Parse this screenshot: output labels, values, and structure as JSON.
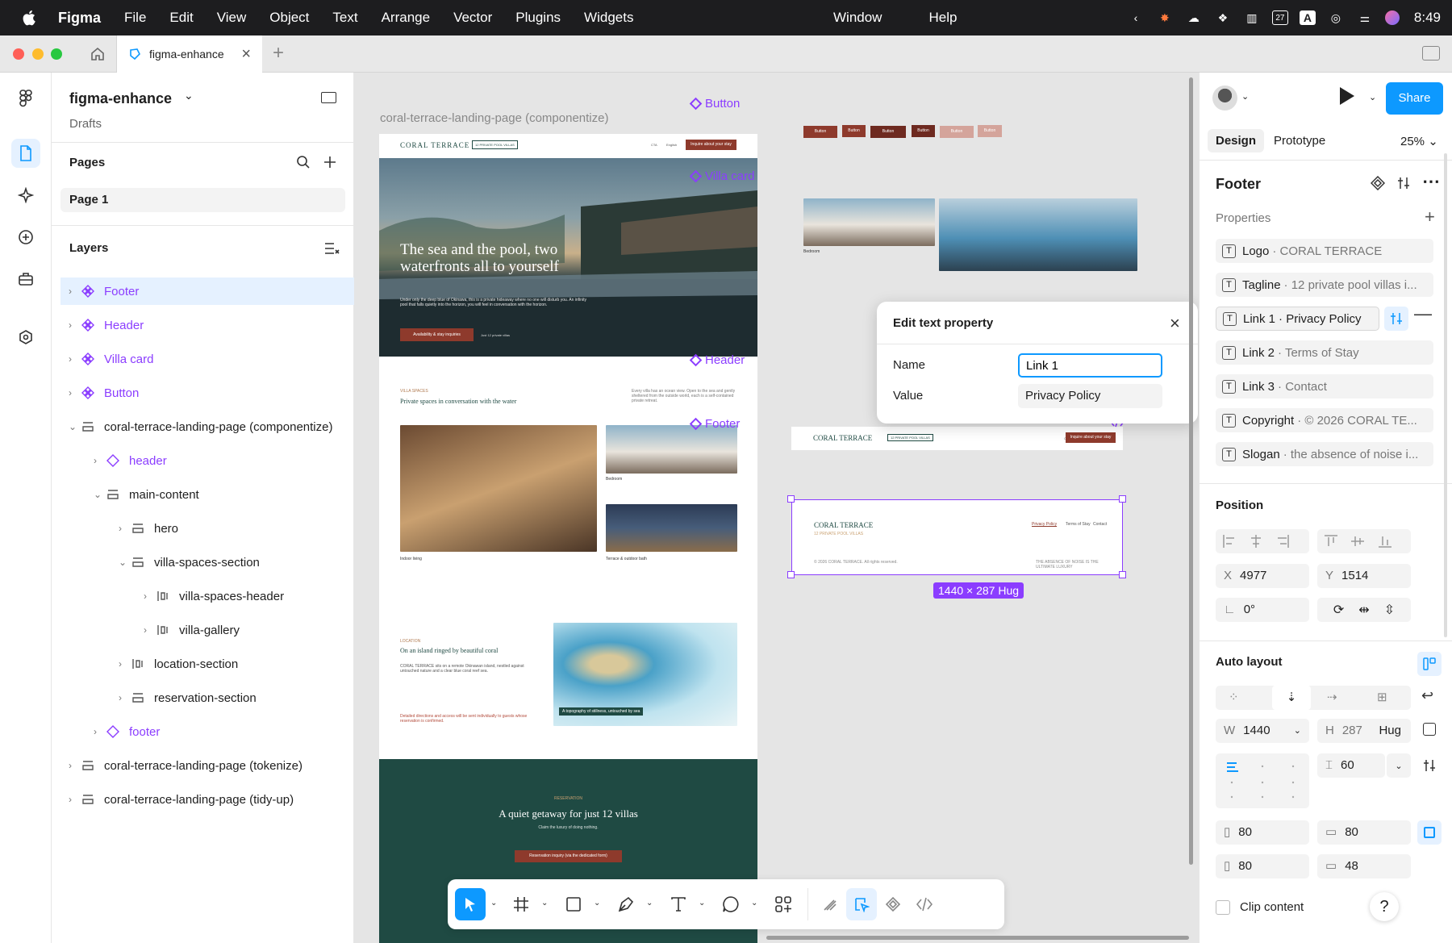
{
  "menubar": {
    "app": "Figma",
    "items": [
      "File",
      "Edit",
      "View",
      "Object",
      "Text",
      "Arrange",
      "Vector",
      "Plugins",
      "Widgets"
    ],
    "right_items": [
      "Window",
      "Help"
    ],
    "clock": "8:49",
    "calendar_day": "27"
  },
  "tabs": {
    "active": "figma-enhance"
  },
  "file": {
    "name": "figma-enhance",
    "location": "Drafts"
  },
  "pages": {
    "title": "Pages",
    "items": [
      "Page 1"
    ]
  },
  "layers": {
    "title": "Layers",
    "items": [
      "Footer",
      "Header",
      "Villa card",
      "Button",
      "coral-terrace-landing-page (componentize)",
      "header",
      "main-content",
      "hero",
      "villa-spaces-section",
      "villa-spaces-header",
      "villa-gallery",
      "location-section",
      "reservation-section",
      "footer",
      "coral-terrace-landing-page (tokenize)",
      "coral-terrace-landing-page (tidy-up)"
    ]
  },
  "canvas": {
    "frame_title": "coral-terrace-landing-page (componentize)",
    "components": {
      "button": "Button",
      "villa_card": "Villa card",
      "header": "Header",
      "footer": "Footer"
    },
    "size_badge": "1440 × 287 Hug",
    "button_variants": [
      "Button",
      "Button",
      "Button",
      "Button",
      "Button",
      "Button"
    ],
    "landing": {
      "brand": "CORAL TERRACE",
      "tag": "12 PRIVATE POOL VILLAS",
      "nav": [
        "CTA",
        "English"
      ],
      "cta": "Inquire about your stay",
      "hero_title": "The sea and the pool, two waterfronts all to yourself",
      "hero_body": "Under only the deep blue of Okinawa, this is a private hideaway where no one will disturb you. An infinity pool that falls quietly into the horizon, you will feel in conversation with the horizon.",
      "hero_btn": "Availability & stay inquiries",
      "hero_note": "Just 12 private villas",
      "spaces_kicker": "VILLA SPACES",
      "spaces_title": "Private spaces in conversation with the water",
      "spaces_body": "Every villa has an ocean view. Open to the sea and gently sheltered from the outside world, each is a self-contained private retreat.",
      "captions": [
        "Indoor living",
        "Bedroom",
        "Terrace & outdoor bath"
      ],
      "location_kicker": "LOCATION",
      "location_title": "On an island ringed by beautiful coral",
      "location_body": "CORAL TERRACE sits on a remote Okinawan island, nestled against untouched nature and a clear blue coral reef sea.",
      "location_note": "Detailed directions and access will be sent individually to guests whose reservation is confirmed.",
      "map_caption": "A topography of stillness, untouched by sea",
      "res_kicker": "RESERVATION",
      "res_title": "A quiet getaway for just 12 villas",
      "res_body": "Claim the luxury of doing nothing.",
      "res_btn": "Reservation inquiry (via the dedicated form)",
      "footer_links": [
        "Privacy Policy",
        "Terms of Stay",
        "Contact"
      ],
      "footer_copy": "© 2026 CORAL TERRACE. All rights reserved.",
      "footer_slogan": "THE ABSENCE OF NOISE IS THE ULTIMATE LUXURY"
    }
  },
  "popup": {
    "title": "Edit text property",
    "name_label": "Name",
    "name_value": "Link 1",
    "value_label": "Value",
    "value_value": "Privacy Policy"
  },
  "right": {
    "share": "Share",
    "tabs": [
      "Design",
      "Prototype"
    ],
    "zoom": "25%",
    "component_name": "Footer",
    "properties_title": "Properties",
    "properties": [
      {
        "name": "Logo",
        "value": "CORAL TERRACE"
      },
      {
        "name": "Tagline",
        "value": "12 private pool villas i..."
      },
      {
        "name": "Link 1",
        "value": "Privacy Policy"
      },
      {
        "name": "Link 2",
        "value": "Terms of Stay"
      },
      {
        "name": "Link 3",
        "value": "Contact"
      },
      {
        "name": "Copyright",
        "value": "© 2026 CORAL TE..."
      },
      {
        "name": "Slogan",
        "value": "the absence of noise i..."
      }
    ],
    "position_title": "Position",
    "x_label": "X",
    "x": "4977",
    "y_label": "Y",
    "y": "1514",
    "rotation": "0°",
    "autolayout_title": "Auto layout",
    "w_label": "W",
    "w": "1440",
    "h_label": "H",
    "h": "287",
    "h_mode": "Hug",
    "gap": "60",
    "pad_left": "80",
    "pad_top": "80",
    "pad_right": "80",
    "pad_bottom": "48",
    "clip_label": "Clip content",
    "help": "?"
  },
  "colors": {
    "accent": "#0d99ff",
    "component": "#8b3dff",
    "brand_button": "#8e3a2c",
    "reservation_band": "#1f4a43"
  }
}
